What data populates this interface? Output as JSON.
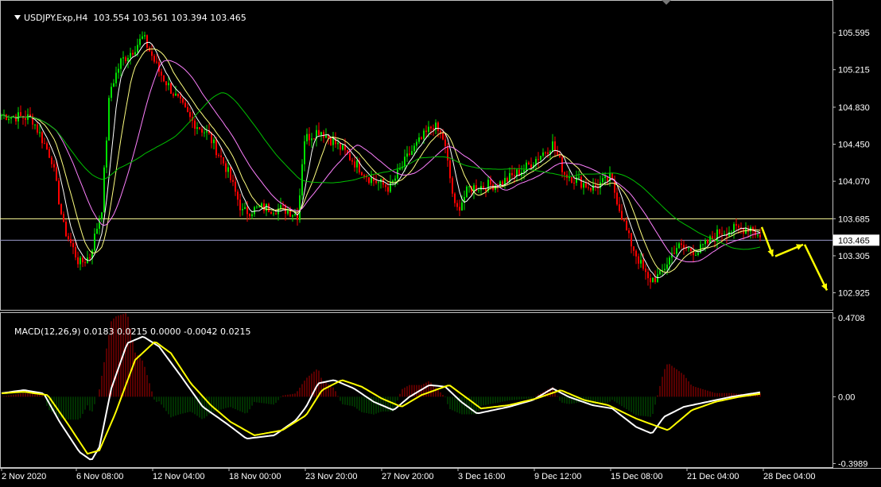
{
  "header": {
    "symbol": "USDJPY.Exp,H4",
    "ohlc": "103.554 103.561 103.394 103.465"
  },
  "macd_header": {
    "label": "MACD(12,26,9)",
    "values": "0.0183 0.0215 0.0000 -0.0042 0.0215"
  },
  "colors": {
    "background": "#000000",
    "bull_candle": "#00e000",
    "bear_candle": "#ff0000",
    "ma_fast": "#ffffff",
    "ma_yellow": "#ffff80",
    "ma_pink": "#ff80ff",
    "ma_green": "#00c000",
    "level_upper": "#ffff99",
    "level_lower": "#9999cc",
    "macd_line": "#ffffff",
    "signal_line": "#ffff00",
    "hist_positive": "#b00000",
    "hist_negative": "#006000",
    "forecast_arrow": "#ffff00"
  },
  "chart_data": [
    {
      "type": "candlestick",
      "title": "USDJPY.Exp,H4",
      "ylim": [
        102.75,
        105.8
      ],
      "yticks": [
        "105.595",
        "105.215",
        "104.830",
        "104.450",
        "104.070",
        "103.685",
        "103.305",
        "102.925"
      ],
      "current_price": "103.465",
      "horizontal_levels": [
        103.685,
        103.465
      ],
      "xticks": [
        "2 Nov 2020",
        "6 Nov 08:00",
        "12 Nov 04:00",
        "18 Nov 00:00",
        "23 Nov 20:00",
        "27 Nov 20:00",
        "3 Dec 16:00",
        "9 Dec 12:00",
        "15 Dec 08:00",
        "21 Dec 04:00",
        "28 Dec 04:00"
      ],
      "anchors": [
        {
          "x": 0,
          "y": 104.75
        },
        {
          "x": 40,
          "y": 104.72
        },
        {
          "x": 65,
          "y": 104.3
        },
        {
          "x": 80,
          "y": 103.6
        },
        {
          "x": 100,
          "y": 103.22
        },
        {
          "x": 113,
          "y": 103.3
        },
        {
          "x": 128,
          "y": 103.8
        },
        {
          "x": 138,
          "y": 105.0
        },
        {
          "x": 152,
          "y": 105.3
        },
        {
          "x": 165,
          "y": 105.4
        },
        {
          "x": 180,
          "y": 105.55
        },
        {
          "x": 200,
          "y": 105.2
        },
        {
          "x": 220,
          "y": 104.95
        },
        {
          "x": 240,
          "y": 104.7
        },
        {
          "x": 262,
          "y": 104.55
        },
        {
          "x": 285,
          "y": 104.2
        },
        {
          "x": 305,
          "y": 103.75
        },
        {
          "x": 330,
          "y": 103.8
        },
        {
          "x": 360,
          "y": 103.78
        },
        {
          "x": 375,
          "y": 103.72
        },
        {
          "x": 382,
          "y": 104.5
        },
        {
          "x": 402,
          "y": 104.6
        },
        {
          "x": 430,
          "y": 104.4
        },
        {
          "x": 465,
          "y": 104.1
        },
        {
          "x": 490,
          "y": 104.0
        },
        {
          "x": 515,
          "y": 104.35
        },
        {
          "x": 545,
          "y": 104.65
        },
        {
          "x": 558,
          "y": 104.5
        },
        {
          "x": 573,
          "y": 103.75
        },
        {
          "x": 590,
          "y": 104.0
        },
        {
          "x": 630,
          "y": 104.05
        },
        {
          "x": 660,
          "y": 104.2
        },
        {
          "x": 695,
          "y": 104.45
        },
        {
          "x": 710,
          "y": 104.15
        },
        {
          "x": 745,
          "y": 104.0
        },
        {
          "x": 768,
          "y": 104.1
        },
        {
          "x": 790,
          "y": 103.5
        },
        {
          "x": 815,
          "y": 103.05
        },
        {
          "x": 830,
          "y": 103.1
        },
        {
          "x": 850,
          "y": 103.4
        },
        {
          "x": 878,
          "y": 103.35
        },
        {
          "x": 905,
          "y": 103.55
        },
        {
          "x": 945,
          "y": 103.6
        },
        {
          "x": 958,
          "y": 103.465
        }
      ],
      "forecast_arrows": [
        {
          "from": [
            958,
            103.6
          ],
          "to": [
            972,
            103.3
          ]
        },
        {
          "from": [
            975,
            103.3
          ],
          "to": [
            1010,
            103.42
          ]
        },
        {
          "from": [
            1012,
            103.42
          ],
          "to": [
            1040,
            102.95
          ]
        }
      ]
    },
    {
      "type": "macd",
      "title": "MACD(12,26,9)",
      "ylim": [
        -0.42,
        0.5
      ],
      "yticks": [
        "0.4708",
        "0.00",
        "-0.3989"
      ],
      "macd_anchors": [
        {
          "x": 0,
          "y": 0.02
        },
        {
          "x": 30,
          "y": 0.04
        },
        {
          "x": 55,
          "y": 0.02
        },
        {
          "x": 75,
          "y": -0.15
        },
        {
          "x": 100,
          "y": -0.33
        },
        {
          "x": 115,
          "y": -0.38
        },
        {
          "x": 125,
          "y": -0.3
        },
        {
          "x": 140,
          "y": 0.05
        },
        {
          "x": 160,
          "y": 0.32
        },
        {
          "x": 180,
          "y": 0.36
        },
        {
          "x": 200,
          "y": 0.3
        },
        {
          "x": 225,
          "y": 0.14
        },
        {
          "x": 255,
          "y": -0.06
        },
        {
          "x": 285,
          "y": -0.16
        },
        {
          "x": 310,
          "y": -0.25
        },
        {
          "x": 345,
          "y": -0.23
        },
        {
          "x": 372,
          "y": -0.14
        },
        {
          "x": 385,
          "y": -0.06
        },
        {
          "x": 400,
          "y": 0.08
        },
        {
          "x": 420,
          "y": 0.1
        },
        {
          "x": 445,
          "y": 0.05
        },
        {
          "x": 470,
          "y": -0.03
        },
        {
          "x": 495,
          "y": -0.08
        },
        {
          "x": 515,
          "y": 0.0
        },
        {
          "x": 540,
          "y": 0.07
        },
        {
          "x": 560,
          "y": 0.06
        },
        {
          "x": 580,
          "y": -0.03
        },
        {
          "x": 600,
          "y": -0.1
        },
        {
          "x": 640,
          "y": -0.06
        },
        {
          "x": 670,
          "y": -0.02
        },
        {
          "x": 695,
          "y": 0.05
        },
        {
          "x": 715,
          "y": 0.0
        },
        {
          "x": 745,
          "y": -0.05
        },
        {
          "x": 770,
          "y": -0.07
        },
        {
          "x": 800,
          "y": -0.18
        },
        {
          "x": 820,
          "y": -0.22
        },
        {
          "x": 835,
          "y": -0.12
        },
        {
          "x": 860,
          "y": -0.06
        },
        {
          "x": 890,
          "y": -0.03
        },
        {
          "x": 920,
          "y": 0.0
        },
        {
          "x": 960,
          "y": 0.03
        }
      ],
      "signal_anchors": [
        {
          "x": 0,
          "y": 0.02
        },
        {
          "x": 30,
          "y": 0.03
        },
        {
          "x": 60,
          "y": 0.01
        },
        {
          "x": 85,
          "y": -0.16
        },
        {
          "x": 110,
          "y": -0.34
        },
        {
          "x": 125,
          "y": -0.32
        },
        {
          "x": 145,
          "y": -0.1
        },
        {
          "x": 170,
          "y": 0.22
        },
        {
          "x": 195,
          "y": 0.33
        },
        {
          "x": 215,
          "y": 0.26
        },
        {
          "x": 240,
          "y": 0.08
        },
        {
          "x": 265,
          "y": -0.05
        },
        {
          "x": 290,
          "y": -0.15
        },
        {
          "x": 320,
          "y": -0.23
        },
        {
          "x": 355,
          "y": -0.2
        },
        {
          "x": 385,
          "y": -0.11
        },
        {
          "x": 405,
          "y": 0.04
        },
        {
          "x": 430,
          "y": 0.1
        },
        {
          "x": 455,
          "y": 0.06
        },
        {
          "x": 480,
          "y": -0.01
        },
        {
          "x": 505,
          "y": -0.06
        },
        {
          "x": 530,
          "y": 0.01
        },
        {
          "x": 565,
          "y": 0.07
        },
        {
          "x": 585,
          "y": 0.0
        },
        {
          "x": 605,
          "y": -0.07
        },
        {
          "x": 640,
          "y": -0.05
        },
        {
          "x": 675,
          "y": -0.01
        },
        {
          "x": 705,
          "y": 0.04
        },
        {
          "x": 735,
          "y": -0.02
        },
        {
          "x": 765,
          "y": -0.05
        },
        {
          "x": 800,
          "y": -0.13
        },
        {
          "x": 840,
          "y": -0.2
        },
        {
          "x": 870,
          "y": -0.08
        },
        {
          "x": 900,
          "y": -0.03
        },
        {
          "x": 930,
          "y": 0.0
        },
        {
          "x": 960,
          "y": 0.02
        }
      ]
    }
  ]
}
